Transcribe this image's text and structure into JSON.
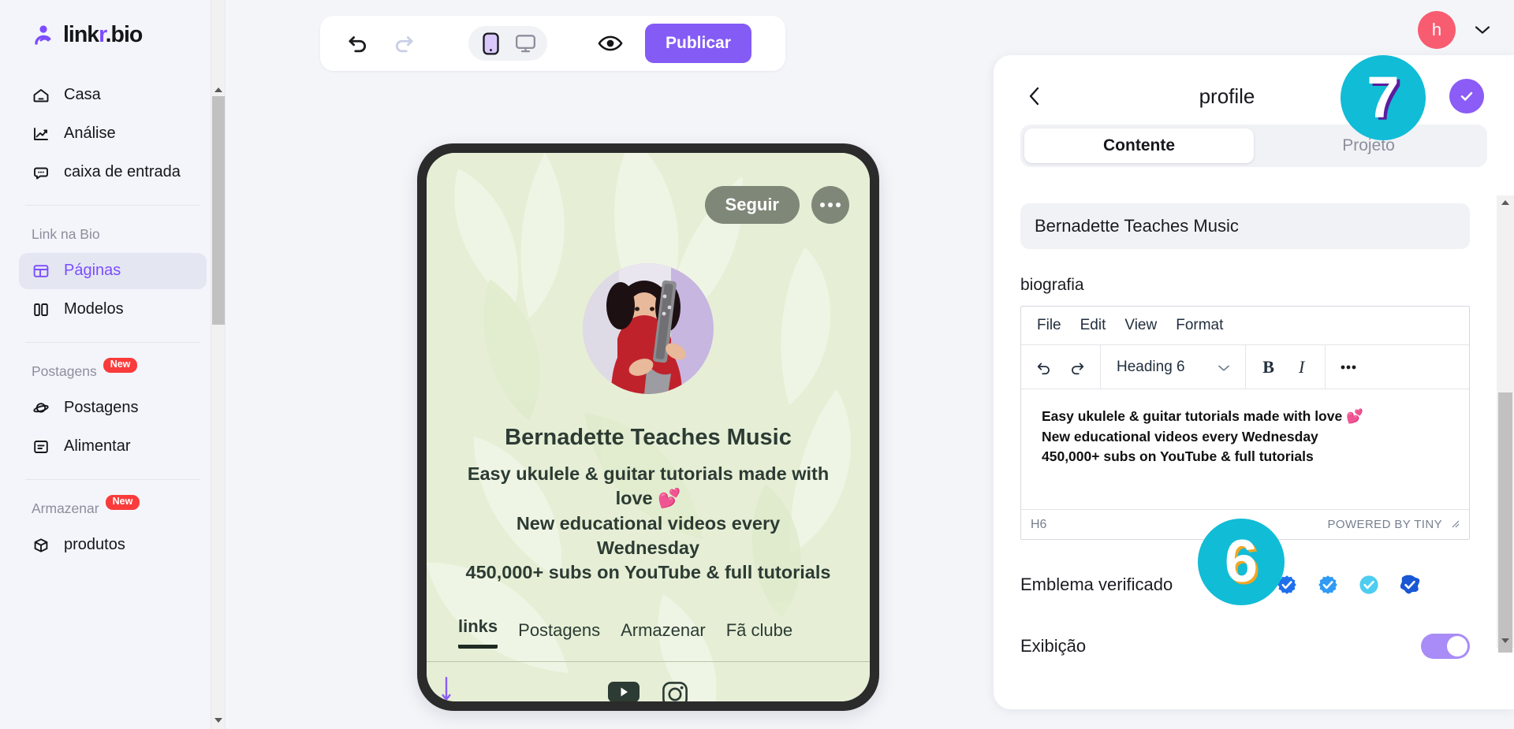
{
  "brand": {
    "name_prefix": "link",
    "name_accent": "r",
    "name_suffix": ".bio",
    "logo_icon": "linkr-logo-icon"
  },
  "sidebar": {
    "items": [
      {
        "label": "Casa",
        "icon": "home-icon",
        "active": false
      },
      {
        "label": "Análise",
        "icon": "chart-line-icon",
        "active": false
      },
      {
        "label": "caixa de entrada",
        "icon": "inbox-chat-icon",
        "active": false
      }
    ],
    "section_linkbio": {
      "label": "Link na Bio"
    },
    "linkbio_items": [
      {
        "label": "Páginas",
        "icon": "layout-icon",
        "active": true
      },
      {
        "label": "Modelos",
        "icon": "templates-icon",
        "active": false
      }
    ],
    "section_posts": {
      "label": "Postagens",
      "badge": "New"
    },
    "posts_items": [
      {
        "label": "Postagens",
        "icon": "planet-icon",
        "active": false
      },
      {
        "label": "Alimentar",
        "icon": "feed-icon",
        "active": false
      }
    ],
    "section_store": {
      "label": "Armazenar",
      "badge": "New"
    },
    "store_items": [
      {
        "label": "produtos",
        "icon": "box-icon",
        "active": false
      }
    ]
  },
  "topbar": {
    "user_initial": "h",
    "user_avatar_color": "#f85c70",
    "chevron_icon": "chevron-down-icon"
  },
  "toolbar": {
    "undo_icon": "undo-icon",
    "redo_icon": "redo-icon",
    "device_mobile_icon": "mobile-icon",
    "device_desktop_icon": "desktop-icon",
    "active_device": "mobile",
    "preview_icon": "eye-icon",
    "publish_label": "Publicar",
    "publish_color": "#845bf5"
  },
  "preview": {
    "follow_label": "Seguir",
    "more_icon": "ellipsis-icon",
    "avatar_icon": "profile-photo",
    "display_name": "Bernadette Teaches Music",
    "bio_lines": [
      "Easy ukulele & guitar tutorials made with love 💕",
      "New educational videos every Wednesday",
      "450,000+ subs on YouTube & full tutorials"
    ],
    "tabs": [
      {
        "label": "links",
        "active": true
      },
      {
        "label": "Postagens",
        "active": false
      },
      {
        "label": "Armazenar",
        "active": false
      },
      {
        "label": "Fã clube",
        "active": false
      }
    ],
    "socials": [
      {
        "name": "youtube-icon"
      },
      {
        "name": "instagram-icon"
      }
    ],
    "bg_color": "#e4eed3",
    "text_color": "#2c3b33"
  },
  "panel": {
    "back_icon": "chevron-left-icon",
    "title": "profile",
    "confirm_icon": "check-circle-icon",
    "confirm_color": "#8b5cf6",
    "tabs": [
      {
        "label": "Contente",
        "active": true
      },
      {
        "label": "Projeto",
        "active": false
      }
    ],
    "name_field": {
      "value": "Bernadette Teaches Music",
      "placeholder": "Name"
    },
    "bio_label": "biografia",
    "editor": {
      "menus": [
        "File",
        "Edit",
        "View",
        "Format"
      ],
      "undo_icon": "undo-icon",
      "redo_icon": "redo-icon",
      "format_select": "Heading 6",
      "select_chevron_icon": "chevron-down-icon",
      "bold_label": "B",
      "italic_label": "I",
      "more_icon": "ellipsis-icon",
      "content_lines": [
        "Easy ukulele & guitar tutorials made with love 💕",
        "New educational videos every Wednesday",
        "450,000+ subs on YouTube & full tutorials"
      ],
      "status_element": "H6",
      "status_brand": "POWERED BY TINY",
      "resize_icon": "resize-handle-icon"
    },
    "verified_badge": {
      "label": "Emblema verificado",
      "options": [
        {
          "name": "badge-none-icon",
          "color": "#9aa0a6",
          "selected": true
        },
        {
          "name": "badge-scallop-darkblue-icon",
          "color": "#1f6feb",
          "selected": false
        },
        {
          "name": "badge-scallop-blue-icon",
          "color": "#2f9bf5",
          "selected": false
        },
        {
          "name": "badge-circle-cyan-icon",
          "color": "#4ecdf0",
          "selected": false
        },
        {
          "name": "badge-diamond-blue-icon",
          "color": "#1b57d4",
          "selected": false
        }
      ]
    },
    "display": {
      "label": "Exibição",
      "enabled": true,
      "on_color": "#a98cf7"
    }
  },
  "annotations": [
    {
      "id": "7",
      "text": "7",
      "color": "#11bcd6"
    },
    {
      "id": "6",
      "text": "6",
      "color": "#11bcd6"
    }
  ]
}
